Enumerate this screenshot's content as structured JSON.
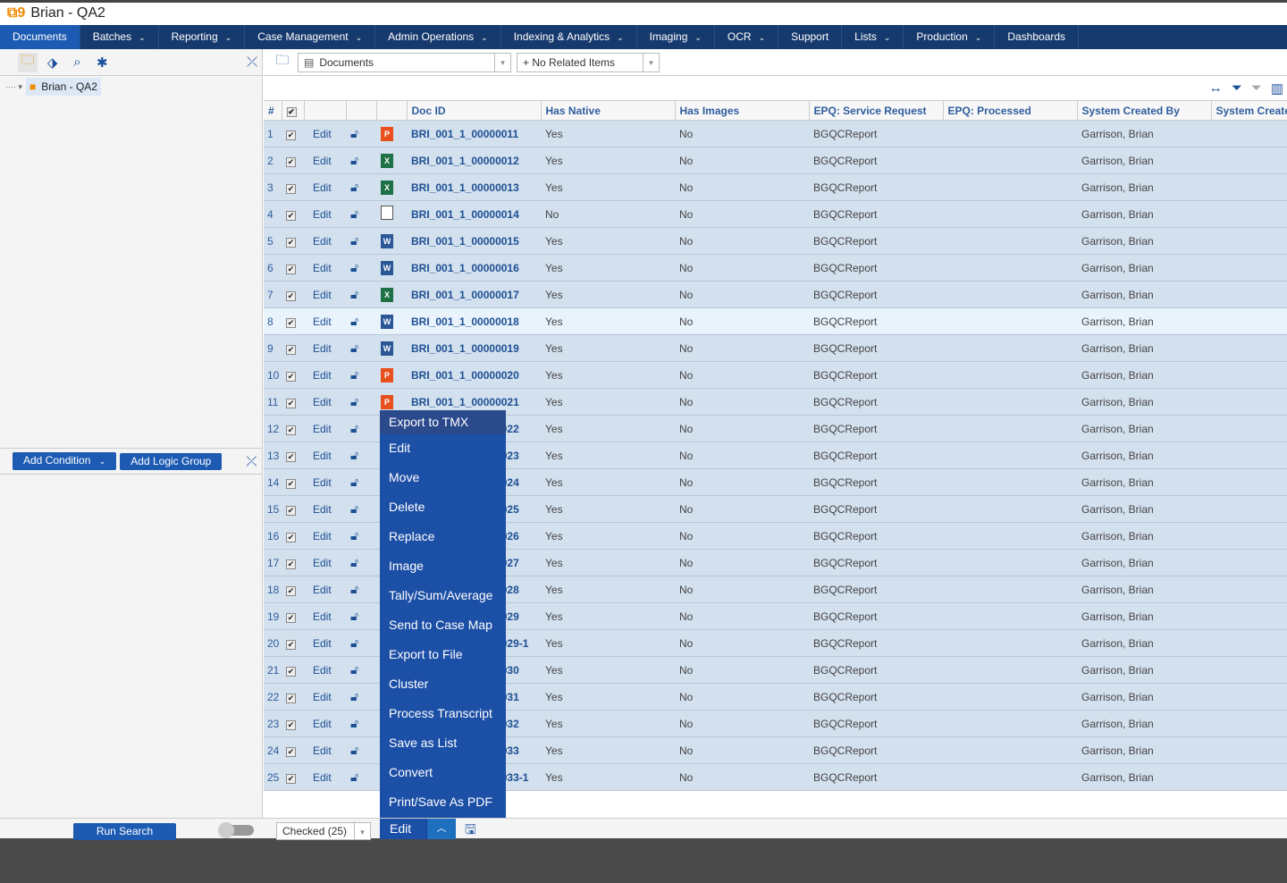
{
  "window": {
    "title": "Brian - QA2"
  },
  "nav": [
    {
      "label": "Documents",
      "dropdown": false,
      "active": true
    },
    {
      "label": "Batches",
      "dropdown": true
    },
    {
      "label": "Reporting",
      "dropdown": true
    },
    {
      "label": "Case Management",
      "dropdown": true
    },
    {
      "label": "Admin Operations",
      "dropdown": true
    },
    {
      "label": "Indexing & Analytics",
      "dropdown": true
    },
    {
      "label": "Imaging",
      "dropdown": true
    },
    {
      "label": "OCR",
      "dropdown": true
    },
    {
      "label": "Support",
      "dropdown": false
    },
    {
      "label": "Lists",
      "dropdown": true
    },
    {
      "label": "Production",
      "dropdown": true
    },
    {
      "label": "Dashboards",
      "dropdown": false
    }
  ],
  "left": {
    "tree_root": "Brian - QA2",
    "add_condition": "Add Condition",
    "add_logic_group": "Add Logic Group",
    "run_search": "Run Search"
  },
  "toolbar": {
    "view_select": "Documents",
    "related_select": "+ No Related Items"
  },
  "grid": {
    "columns": [
      "#",
      "",
      "",
      "",
      "Doc ID",
      "Has Native",
      "Has Images",
      "EPQ: Service Request",
      "EPQ: Processed",
      "System Created By",
      "System Create"
    ],
    "edit_label": "Edit",
    "rows": [
      {
        "n": "1",
        "type": "ppt",
        "id": "BRI_001_1_00000011",
        "native": "Yes",
        "images": "No",
        "sr": "BGQCReport",
        "processed": "",
        "created_by": "Garrison, Brian"
      },
      {
        "n": "2",
        "type": "xls",
        "id": "BRI_001_1_00000012",
        "native": "Yes",
        "images": "No",
        "sr": "BGQCReport",
        "processed": "",
        "created_by": "Garrison, Brian"
      },
      {
        "n": "3",
        "type": "xls",
        "id": "BRI_001_1_00000013",
        "native": "Yes",
        "images": "No",
        "sr": "BGQCReport",
        "processed": "",
        "created_by": "Garrison, Brian"
      },
      {
        "n": "4",
        "type": "blank",
        "id": "BRI_001_1_00000014",
        "native": "No",
        "images": "No",
        "sr": "BGQCReport",
        "processed": "",
        "created_by": "Garrison, Brian"
      },
      {
        "n": "5",
        "type": "doc",
        "id": "BRI_001_1_00000015",
        "native": "Yes",
        "images": "No",
        "sr": "BGQCReport",
        "processed": "",
        "created_by": "Garrison, Brian"
      },
      {
        "n": "6",
        "type": "doc",
        "id": "BRI_001_1_00000016",
        "native": "Yes",
        "images": "No",
        "sr": "BGQCReport",
        "processed": "",
        "created_by": "Garrison, Brian"
      },
      {
        "n": "7",
        "type": "xls",
        "id": "BRI_001_1_00000017",
        "native": "Yes",
        "images": "No",
        "sr": "BGQCReport",
        "processed": "",
        "created_by": "Garrison, Brian"
      },
      {
        "n": "8",
        "type": "doc",
        "id": "BRI_001_1_00000018",
        "native": "Yes",
        "images": "No",
        "sr": "BGQCReport",
        "processed": "",
        "created_by": "Garrison, Brian",
        "highlighted": true
      },
      {
        "n": "9",
        "type": "doc",
        "id": "BRI_001_1_00000019",
        "native": "Yes",
        "images": "No",
        "sr": "BGQCReport",
        "processed": "",
        "created_by": "Garrison, Brian"
      },
      {
        "n": "10",
        "type": "ppt",
        "id": "BRI_001_1_00000020",
        "native": "Yes",
        "images": "No",
        "sr": "BGQCReport",
        "processed": "",
        "created_by": "Garrison, Brian"
      },
      {
        "n": "11",
        "type": "ppt",
        "id": "BRI_001_1_00000021",
        "native": "Yes",
        "images": "No",
        "sr": "BGQCReport",
        "processed": "",
        "created_by": "Garrison, Brian"
      },
      {
        "n": "12",
        "type": "",
        "id": "BRI_001_1_00000022",
        "native": "Yes",
        "images": "No",
        "sr": "BGQCReport",
        "processed": "",
        "created_by": "Garrison, Brian"
      },
      {
        "n": "13",
        "type": "",
        "id": "BRI_001_1_00000023",
        "native": "Yes",
        "images": "No",
        "sr": "BGQCReport",
        "processed": "",
        "created_by": "Garrison, Brian"
      },
      {
        "n": "14",
        "type": "",
        "id": "BRI_001_1_00000024",
        "native": "Yes",
        "images": "No",
        "sr": "BGQCReport",
        "processed": "",
        "created_by": "Garrison, Brian"
      },
      {
        "n": "15",
        "type": "",
        "id": "BRI_001_1_00000025",
        "native": "Yes",
        "images": "No",
        "sr": "BGQCReport",
        "processed": "",
        "created_by": "Garrison, Brian"
      },
      {
        "n": "16",
        "type": "",
        "id": "BRI_001_1_00000026",
        "native": "Yes",
        "images": "No",
        "sr": "BGQCReport",
        "processed": "",
        "created_by": "Garrison, Brian"
      },
      {
        "n": "17",
        "type": "",
        "id": "BRI_001_1_00000027",
        "native": "Yes",
        "images": "No",
        "sr": "BGQCReport",
        "processed": "",
        "created_by": "Garrison, Brian"
      },
      {
        "n": "18",
        "type": "",
        "id": "BRI_001_1_00000028",
        "native": "Yes",
        "images": "No",
        "sr": "BGQCReport",
        "processed": "",
        "created_by": "Garrison, Brian"
      },
      {
        "n": "19",
        "type": "",
        "id": "BRI_001_1_00000029",
        "native": "Yes",
        "images": "No",
        "sr": "BGQCReport",
        "processed": "",
        "created_by": "Garrison, Brian"
      },
      {
        "n": "20",
        "type": "",
        "id": "BRI_001_1_00000029-1",
        "native": "Yes",
        "images": "No",
        "sr": "BGQCReport",
        "processed": "",
        "created_by": "Garrison, Brian"
      },
      {
        "n": "21",
        "type": "",
        "id": "BRI_001_1_00000030",
        "native": "Yes",
        "images": "No",
        "sr": "BGQCReport",
        "processed": "",
        "created_by": "Garrison, Brian"
      },
      {
        "n": "22",
        "type": "",
        "id": "BRI_001_1_00000031",
        "native": "Yes",
        "images": "No",
        "sr": "BGQCReport",
        "processed": "",
        "created_by": "Garrison, Brian"
      },
      {
        "n": "23",
        "type": "",
        "id": "BRI_001_1_00000032",
        "native": "Yes",
        "images": "No",
        "sr": "BGQCReport",
        "processed": "",
        "created_by": "Garrison, Brian"
      },
      {
        "n": "24",
        "type": "",
        "id": "BRI_001_1_00000033",
        "native": "Yes",
        "images": "No",
        "sr": "BGQCReport",
        "processed": "",
        "created_by": "Garrison, Brian"
      },
      {
        "n": "25",
        "type": "",
        "id": "BRI_001_1_00000033-1",
        "native": "Yes",
        "images": "No",
        "sr": "BGQCReport",
        "processed": "",
        "created_by": "Garrison, Brian"
      }
    ]
  },
  "context_menu": [
    "Export to TMX",
    "Edit",
    "Move",
    "Delete",
    "Replace",
    "Image",
    "Tally/Sum/Average",
    "Send to Case Map",
    "Export to File",
    "Cluster",
    "Process Transcript",
    "Save as List",
    "Convert",
    "Print/Save As PDF"
  ],
  "bottom": {
    "checked_select": "Checked (25)",
    "edit_button": "Edit"
  },
  "colors": {
    "nav": "#173a6e",
    "accent": "#1d5bb3",
    "row": "#d3e0ee",
    "logo": "#f08a00"
  }
}
